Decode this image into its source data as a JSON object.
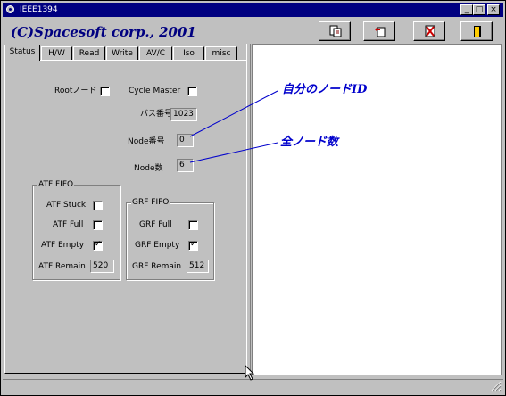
{
  "window": {
    "title": "IEEE1394",
    "minimize": "_",
    "maximize": "□",
    "close": "×"
  },
  "header": {
    "brand": "(C)Spacesoft corp., 2001"
  },
  "toolbar": {
    "icons": [
      "save-icon",
      "open-icon",
      "clear-icon",
      "exit-icon"
    ]
  },
  "tabs": [
    "Status",
    "H/W",
    "Read",
    "Write",
    "AV/C",
    "Iso",
    "misc"
  ],
  "status_tab": {
    "root_label": "Rootノード",
    "root_checked": false,
    "cycle_master_label": "Cycle Master",
    "cycle_master_checked": false,
    "bus_number_label": "バス番号",
    "bus_number": "1023",
    "node_number_label": "Node番号",
    "node_number": "0",
    "node_count_label": "Node数",
    "node_count": "6"
  },
  "atf_fifo": {
    "title": "ATF FIFO",
    "stuck_label": "ATF Stuck",
    "stuck_checked": false,
    "full_label": "ATF Full",
    "full_checked": false,
    "empty_label": "ATF Empty",
    "empty_checked": true,
    "remain_label": "ATF Remain",
    "remain": "520"
  },
  "grf_fifo": {
    "title": "GRF FIFO",
    "full_label": "GRF Full",
    "full_checked": false,
    "empty_label": "GRF Empty",
    "empty_checked": true,
    "remain_label": "GRF Remain",
    "remain": "512"
  },
  "annotations": {
    "node_id": "自分のノードID",
    "node_total": "全ノード数"
  },
  "checkmark": "✓"
}
